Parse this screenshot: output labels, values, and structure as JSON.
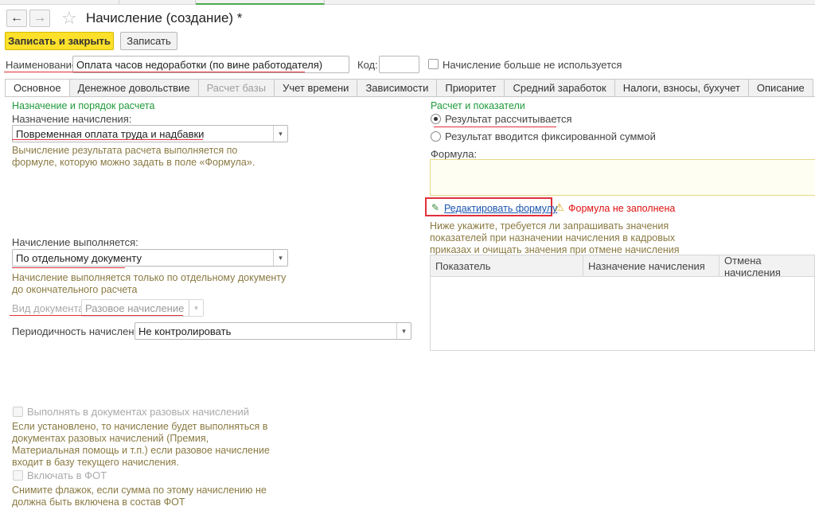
{
  "window": {
    "title": "Начисление (создание) *"
  },
  "toolbar": {
    "save_close_label": "Записать и закрыть",
    "save_label": "Записать"
  },
  "header": {
    "name_label": "Наименование:",
    "name_value": "Оплата часов недоработки (по вине работодателя)",
    "code_label": "Код:",
    "code_value": "",
    "unused_label": "Начисление больше не используется"
  },
  "tabs": [
    {
      "label": "Основное",
      "active": true
    },
    {
      "label": "Денежное довольствие"
    },
    {
      "label": "Расчет базы",
      "disabled": true
    },
    {
      "label": "Учет времени"
    },
    {
      "label": "Зависимости"
    },
    {
      "label": "Приоритет"
    },
    {
      "label": "Средний заработок"
    },
    {
      "label": "Налоги, взносы, бухучет"
    },
    {
      "label": "Описание"
    }
  ],
  "left": {
    "section_title": "Назначение и порядок расчета",
    "purpose_label": "Назначение начисления:",
    "purpose_value": "Повременная оплата труда и надбавки",
    "purpose_hint": "Вычисление результата расчета выполняется по формуле, которую можно задать в поле «Формула».",
    "executed_label": "Начисление выполняется:",
    "executed_value": "По отдельному документу",
    "executed_hint": "Начисление выполняется только по отдельному документу до окончательного расчета",
    "doctype_label": "Вид документа:",
    "doctype_value": "Разовое начисление",
    "periodicity_label": "Периодичность начисления:",
    "periodicity_value": "Не контролировать",
    "oneoff_label": "Выполнять в документах разовых начислений",
    "oneoff_hint": "Если установлено, то начисление будет выполняться в документах разовых начислений (Премия, Материальная помощь и т.п.) если разовое начисление входит в базу текущего начисления.",
    "fot_label": "Включать в ФОТ",
    "fot_hint": "Снимите флажок, если сумма по этому начислению не должна быть включена в состав ФОТ"
  },
  "right": {
    "section_title": "Расчет и показатели",
    "radio_calc_label": "Результат рассчитывается",
    "radio_fixed_label": "Результат вводится фиксированной суммой",
    "formula_label": "Формула:",
    "formula_value": "",
    "edit_formula_link": "Редактировать формулу",
    "formula_warning": "Формула не заполнена",
    "indicators_hint": "Ниже укажите, требуется ли запрашивать значения показателей при назначении начисления в кадровых приказах и очищать значения при отмене начисления",
    "table_headers": [
      "Показатель",
      "Назначение начисления",
      "Отмена начисления"
    ]
  },
  "colors": {
    "accent_yellow": "#fde02a",
    "section_green": "#1f9a3a",
    "hint_olive": "#8a7a42",
    "highlight_red": "#e0303a",
    "link_blue": "#1a55b0"
  }
}
